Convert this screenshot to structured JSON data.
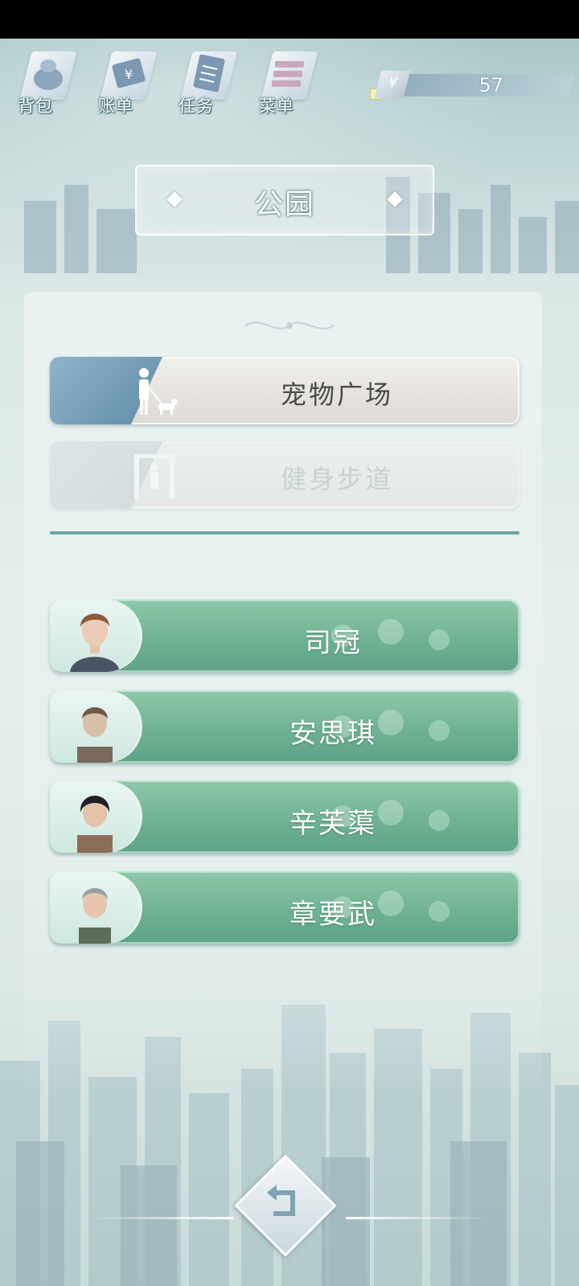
{
  "menu": {
    "items": [
      {
        "label": "背包",
        "icon": "bag-icon"
      },
      {
        "label": "账单",
        "icon": "bill-icon"
      },
      {
        "label": "任务",
        "icon": "task-icon"
      },
      {
        "label": "菜单",
        "icon": "menu-icon"
      }
    ]
  },
  "currency": {
    "symbol": "¥",
    "value": "57"
  },
  "location": {
    "title": "公园"
  },
  "places": [
    {
      "label": "宠物广场",
      "icon": "dog-walker-icon",
      "enabled": true
    },
    {
      "label": "健身步道",
      "icon": "fitness-icon",
      "enabled": false
    }
  ],
  "npcs": [
    {
      "name": "司冠"
    },
    {
      "name": "安思琪"
    },
    {
      "name": "辛芙蕖"
    },
    {
      "name": "章要武"
    }
  ],
  "colors": {
    "npc_button": "#6fb293",
    "place_icon_bg": "#5f8aa6",
    "label_outline": "#3a6670"
  }
}
